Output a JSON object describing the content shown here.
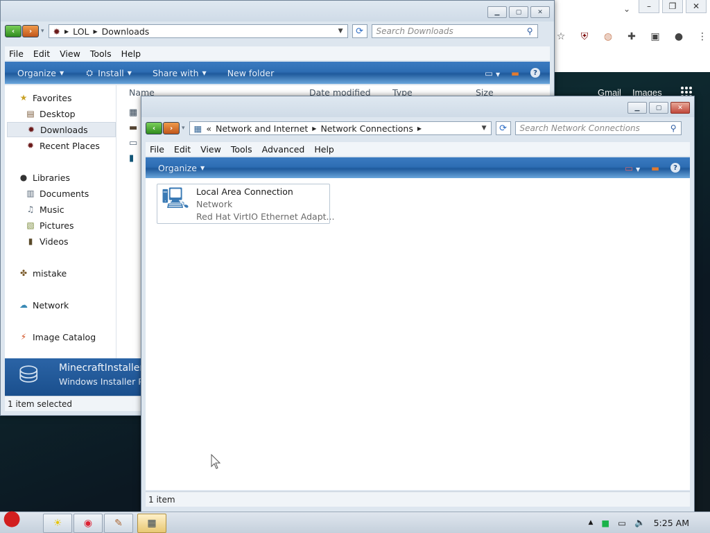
{
  "chrome": {
    "google_links": [
      "Gmail",
      "Images"
    ]
  },
  "downloads_window": {
    "breadcrumb": [
      "LOL",
      "Downloads"
    ],
    "search_placeholder": "Search Downloads",
    "menu": [
      "File",
      "Edit",
      "View",
      "Tools",
      "Help"
    ],
    "commands": {
      "organize": "Organize",
      "install": "Install",
      "share_with": "Share with",
      "new_folder": "New folder"
    },
    "columns": [
      "Name",
      "Date modified",
      "Type",
      "Size"
    ],
    "nav": {
      "favorites": "Favorites",
      "desktop": "Desktop",
      "downloads": "Downloads",
      "recent_places": "Recent Places",
      "libraries": "Libraries",
      "documents": "Documents",
      "music": "Music",
      "pictures": "Pictures",
      "videos": "Videos",
      "mistake": "mistake",
      "network": "Network",
      "image_catalog": "Image Catalog"
    },
    "details": {
      "name": "MinecraftInstaller.m",
      "type": "Windows Installer Pa"
    },
    "status": "1 item selected"
  },
  "network_window": {
    "breadcrumb": [
      "Network and Internet",
      "Network Connections"
    ],
    "search_placeholder": "Search Network Connections",
    "menu": [
      "File",
      "Edit",
      "View",
      "Tools",
      "Advanced",
      "Help"
    ],
    "commands": {
      "organize": "Organize"
    },
    "connection": {
      "name": "Local Area Connection",
      "status": "Network",
      "adapter": "Red Hat VirtIO Ethernet Adapt..."
    },
    "status": "1 item"
  },
  "taskbar": {
    "clock": "5:25 AM"
  }
}
